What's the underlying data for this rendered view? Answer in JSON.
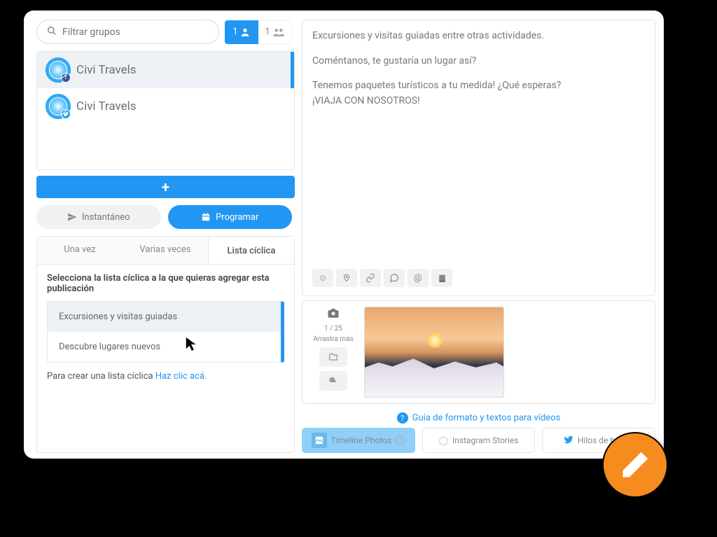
{
  "search": {
    "placeholder": "Filtrar grupos"
  },
  "peopleCounts": {
    "single": "1",
    "group": "1"
  },
  "accounts": [
    {
      "name": "Civi Travels",
      "network": "fb"
    },
    {
      "name": "Civi Travels",
      "network": "tw"
    }
  ],
  "modes": {
    "instant": "Instantáneo",
    "schedule": "Programar"
  },
  "tabs": {
    "once": "Una vez",
    "multi": "Varias veces",
    "cyclic": "Lista cíclica"
  },
  "cyclicPanel": {
    "instruction": "Selecciona la lista cíclica a la que quieras agregar esta publicación",
    "options": [
      "Excursiones y visitas guiadas",
      "Descubre lugares nuevos"
    ],
    "createPrefix": "Para crear una lista cíclica ",
    "createLink": "Haz clic acá."
  },
  "compose": {
    "line1": "Excursiones y visitas guiadas entre otras actividades.",
    "line2": "Coméntanos, te gustaría un lugar así?",
    "line3a": "Tenemos paquetes turísticos a tu medida! ¿Qué esperas?",
    "line3b": "¡VIAJA CON NOSOTROS!"
  },
  "media": {
    "count": "1 / 25",
    "dragMore": "Arrastra más"
  },
  "guideLink": "Guía de formato y textos para vídeos",
  "albumRow": {
    "timeline": "Timeline Photos",
    "stories": "Instagram Stories",
    "threads": "Hilos de twitter"
  }
}
